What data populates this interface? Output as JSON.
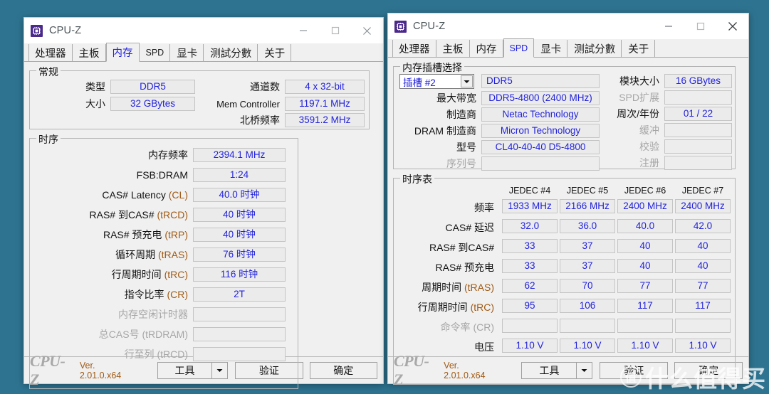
{
  "desktop": {
    "background": "#2e7491"
  },
  "watermark": {
    "logo_char": "值",
    "text": "什么值得买"
  },
  "left_window": {
    "title": "CPU-Z",
    "icon": "cpuz-logo-icon",
    "window_buttons": {
      "minimize": "minimize-icon",
      "maximize": "maximize-icon",
      "close": "close-icon"
    },
    "tabs": [
      {
        "label": "处理器",
        "active": false
      },
      {
        "label": "主板",
        "active": false
      },
      {
        "label": "内存",
        "active": true
      },
      {
        "label": "SPD",
        "active": false
      },
      {
        "label": "显卡",
        "active": false
      },
      {
        "label": "测試分數",
        "active": false
      },
      {
        "label": "关于",
        "active": false
      }
    ],
    "general": {
      "legend": "常规",
      "type_label": "类型",
      "type_value": "DDR5",
      "size_label": "大小",
      "size_value": "32 GBytes",
      "channels_label": "通道数",
      "channels_value": "4 x 32-bit",
      "memctrl_label": "Mem Controller",
      "memctrl_value": "1197.1 MHz",
      "nbfreq_label": "北桥频率",
      "nbfreq_value": "3591.2 MHz"
    },
    "timings": {
      "legend": "时序",
      "rows": [
        {
          "label": "内存频率",
          "abbr": "",
          "value": "2394.1 MHz",
          "disabled": false
        },
        {
          "label": "FSB:DRAM",
          "abbr": "",
          "value": "1:24",
          "disabled": false
        },
        {
          "label": "CAS# Latency ",
          "abbr": "(CL)",
          "value": "40.0 时钟",
          "disabled": false
        },
        {
          "label": "RAS# 到CAS# ",
          "abbr": "(tRCD)",
          "value": "40 时钟",
          "disabled": false
        },
        {
          "label": "RAS# 预充电 ",
          "abbr": "(tRP)",
          "value": "40 时钟",
          "disabled": false
        },
        {
          "label": "循环周期 ",
          "abbr": "(tRAS)",
          "value": "76 时钟",
          "disabled": false
        },
        {
          "label": "行周期时间 ",
          "abbr": "(tRC)",
          "value": "116 时钟",
          "disabled": false
        },
        {
          "label": "指令比率 ",
          "abbr": "(CR)",
          "value": "2T",
          "disabled": false
        },
        {
          "label": "内存空闲计时器",
          "abbr": "",
          "value": "",
          "disabled": true
        },
        {
          "label": "总CAS号 ",
          "abbr": "(tRDRAM)",
          "value": "",
          "disabled": true
        },
        {
          "label": "行至列 ",
          "abbr": "(tRCD)",
          "value": "",
          "disabled": true
        }
      ]
    },
    "statusbar": {
      "brand": "CPU-Z",
      "version": "Ver. 2.01.0.x64",
      "tools_label": "工具",
      "dropdown_icon": "chevron-down-icon",
      "validate_label": "验证",
      "ok_label": "确定"
    }
  },
  "right_window": {
    "title": "CPU-Z",
    "icon": "cpuz-logo-icon",
    "window_buttons": {
      "minimize": "minimize-icon",
      "maximize": "maximize-icon",
      "close": "close-icon"
    },
    "tabs": [
      {
        "label": "处理器",
        "active": false
      },
      {
        "label": "主板",
        "active": false
      },
      {
        "label": "内存",
        "active": false
      },
      {
        "label": "SPD",
        "active": true
      },
      {
        "label": "显卡",
        "active": false
      },
      {
        "label": "测試分數",
        "active": false
      },
      {
        "label": "关于",
        "active": false
      }
    ],
    "slot_select": {
      "legend": "内存插槽选择",
      "slot_value": "插槽 #2",
      "slot_dropdown_icon": "chevron-down-icon",
      "module_type": "DDR5",
      "left_rows": [
        {
          "label": "最大带宽",
          "value": "DDR5-4800 (2400 MHz)",
          "disabled": false
        },
        {
          "label": "制造商",
          "value": "Netac Technology",
          "disabled": false
        },
        {
          "label": "DRAM 制造商",
          "value": "Micron Technology",
          "disabled": false
        },
        {
          "label": "型号",
          "value": "CL40-40-40 D5-4800",
          "disabled": false
        },
        {
          "label": "序列号",
          "value": "",
          "disabled": true
        }
      ],
      "right_rows": [
        {
          "label": "模块大小",
          "value": "16 GBytes",
          "disabled": false
        },
        {
          "label": "SPD扩展",
          "value": "",
          "disabled": true
        },
        {
          "label": "周次/年份",
          "value": "01 / 22",
          "disabled": false
        },
        {
          "label": "缓冲",
          "value": "",
          "disabled": true
        },
        {
          "label": "校验",
          "value": "",
          "disabled": true
        },
        {
          "label": "注册",
          "value": "",
          "disabled": true
        }
      ]
    },
    "timing_table": {
      "legend": "时序表",
      "columns": [
        "JEDEC #4",
        "JEDEC #5",
        "JEDEC #6",
        "JEDEC #7"
      ],
      "rows": [
        {
          "label": "频率",
          "abbr": "",
          "values": [
            "1933 MHz",
            "2166 MHz",
            "2400 MHz",
            "2400 MHz"
          ],
          "disabled": false
        },
        {
          "label": "CAS# 延迟",
          "abbr": "",
          "values": [
            "32.0",
            "36.0",
            "40.0",
            "42.0"
          ],
          "disabled": false
        },
        {
          "label": "RAS# 到CAS#",
          "abbr": "",
          "values": [
            "33",
            "37",
            "40",
            "40"
          ],
          "disabled": false
        },
        {
          "label": "RAS# 预充电",
          "abbr": "",
          "values": [
            "33",
            "37",
            "40",
            "40"
          ],
          "disabled": false
        },
        {
          "label": "周期时间 ",
          "abbr": "(tRAS)",
          "values": [
            "62",
            "70",
            "77",
            "77"
          ],
          "disabled": false
        },
        {
          "label": "行周期时间 ",
          "abbr": "(tRC)",
          "values": [
            "95",
            "106",
            "117",
            "117"
          ],
          "disabled": false
        },
        {
          "label": "命令率 ",
          "abbr": "(CR)",
          "values": [
            "",
            "",
            "",
            ""
          ],
          "disabled": true
        },
        {
          "label": "电压",
          "abbr": "",
          "values": [
            "1.10 V",
            "1.10 V",
            "1.10 V",
            "1.10 V"
          ],
          "disabled": false
        }
      ]
    },
    "statusbar": {
      "brand": "CPU-Z",
      "version": "Ver. 2.01.0.x64",
      "tools_label": "工具",
      "dropdown_icon": "chevron-down-icon",
      "validate_label": "验证",
      "ok_label": "确定"
    }
  }
}
